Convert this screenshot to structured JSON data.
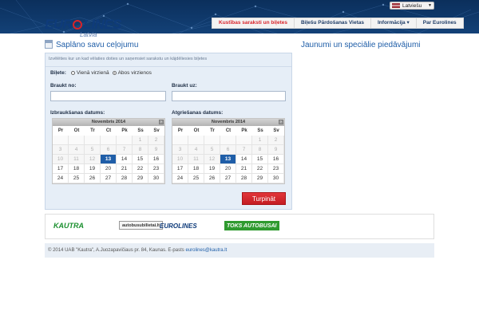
{
  "header": {
    "language": "Latviešu",
    "brand": {
      "name": "EUROLINES",
      "sub": "Latvia"
    },
    "nav": [
      "Kustības saraksti un biļetes",
      "Biļešu Pārdošanas Vietas",
      "Informācija",
      "Par Eurolines"
    ]
  },
  "planner": {
    "title": "Saplāno savu ceļojumu",
    "hint": "Izvēlēties kur un kad vēlaties doties un saņemsiet sarakstu un kājdēliesies biļetes",
    "ticket_label": "Biļete:",
    "one_way": "Vienā virzienā",
    "round_trip": "Abos virzienos",
    "from_label": "Braukt no:",
    "to_label": "Braukt uz:",
    "depart_label": "Izbraukšanas datums:",
    "return_label": "Atgriešanas datums:",
    "next_button": "Turpināt",
    "calendars": [
      {
        "month": "Novembris 2014",
        "days": [
          "Pr",
          "Ot",
          "Tr",
          "Ct",
          "Pk",
          "Ss",
          "Sv"
        ],
        "weeks": [
          [
            "",
            "",
            "",
            "",
            "",
            "1",
            "2"
          ],
          [
            "3",
            "4",
            "5",
            "6",
            "7",
            "8",
            "9"
          ],
          [
            "10",
            "11",
            "12",
            "13",
            "14",
            "15",
            "16"
          ],
          [
            "17",
            "18",
            "19",
            "20",
            "21",
            "22",
            "23"
          ],
          [
            "24",
            "25",
            "26",
            "27",
            "28",
            "29",
            "30"
          ]
        ],
        "selected": "13"
      },
      {
        "month": "Novembris 2014",
        "days": [
          "Pr",
          "Ot",
          "Tr",
          "Ct",
          "Pk",
          "Ss",
          "Sv"
        ],
        "weeks": [
          [
            "",
            "",
            "",
            "",
            "",
            "1",
            "2"
          ],
          [
            "3",
            "4",
            "5",
            "6",
            "7",
            "8",
            "9"
          ],
          [
            "10",
            "11",
            "12",
            "13",
            "14",
            "15",
            "16"
          ],
          [
            "17",
            "18",
            "19",
            "20",
            "21",
            "22",
            "23"
          ],
          [
            "24",
            "25",
            "26",
            "27",
            "28",
            "29",
            "30"
          ]
        ],
        "selected": "13"
      }
    ]
  },
  "offers": {
    "title": "Jaunumi un speciālie piedāvājumi"
  },
  "partners": [
    "KAUTRA",
    "autobusubilietai.lt",
    "EUROLINES",
    "TOKS AUTOBUSAI"
  ],
  "footer": {
    "text": "© 2014 UAB \"Kautra\", A.Juozapavičiaus pr. 84, Kaunas. E-pasts ",
    "email": "eurolines@kautra.lt"
  },
  "colors": {
    "brand_blue": "#1f5ea8",
    "accent_red": "#d8232a",
    "panel_bg": "#e6eef7"
  }
}
